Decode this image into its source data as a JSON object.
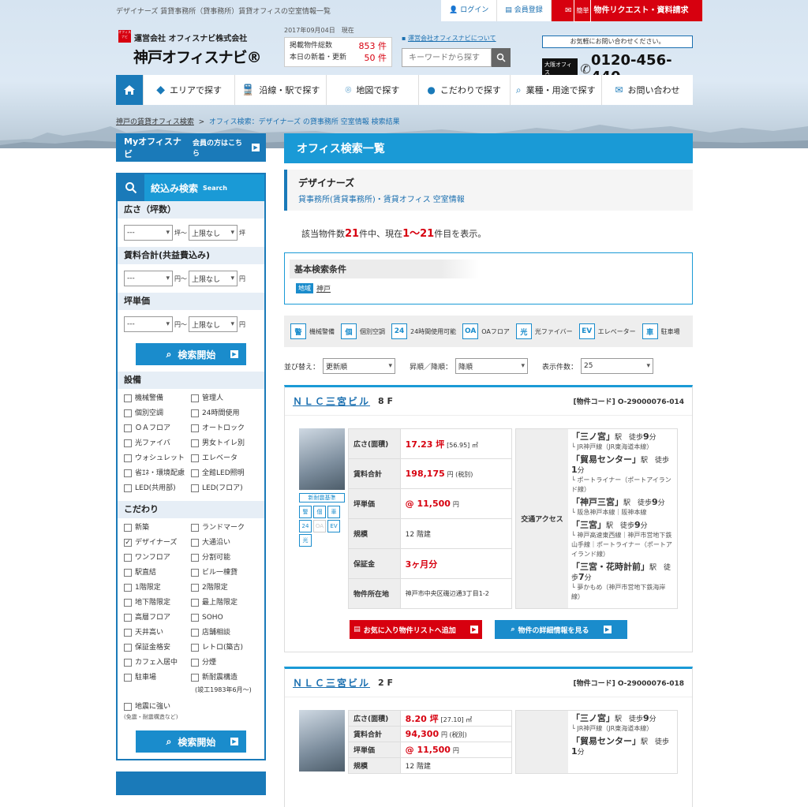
{
  "header": {
    "tagline": "デザイナーズ 賃貸事務所（貸事務所）賃貸オフィスの空室情報一覧",
    "login": "ログイン",
    "register": "会員登録",
    "request_tag": "簡単",
    "request": "物件リクエスト・資料請求",
    "logo_mark": "オフィスナビ",
    "company": "運営会社 オフィスナビ株式会社",
    "logo": "神戸オフィスナビ®",
    "date": "2017年09月04日　現在",
    "total_label": "掲載物件総数",
    "total_value": "853 件",
    "new_label": "本日の新着・更新",
    "new_value": "50 件",
    "about": "運営会社オフィスナビについて",
    "search_placeholder": "キーワードから探す",
    "contact_q": "お気軽にお問い合わせください。",
    "osaka": "大阪オフィス",
    "tel": "0120-456-440"
  },
  "nav": [
    "エリアで探す",
    "沿線・駅で探す",
    "地図で探す",
    "こだわりで探す",
    "業種・用途で探す",
    "お問い合わせ"
  ],
  "breadcrumb": {
    "home": "神戸の賃貸オフィス検索",
    "sep": ">",
    "current": "オフィス検索：デザイナーズ の貸事務所 空室情報 検索結果"
  },
  "sidebar": {
    "my_label": "Myオフィスナビ",
    "my_sub": "会員の方はこちら",
    "filter_title": "絞込み検索",
    "filter_sub": "Search",
    "area_hd": "広さ（坪数）",
    "area_unit1": "坪～",
    "area_unit2": "坪",
    "rent_hd": "賃料合計(共益費込み)",
    "yen1": "円～",
    "yen2": "円",
    "tsubo_hd": "坪単価",
    "min_val": "---",
    "max_val": "上限なし",
    "search_btn": "検索開始",
    "equip_hd": "設備",
    "equip": [
      "機械警備",
      "管理人",
      "個別空調",
      "24時間使用",
      "ＯＡフロア",
      "オートロック",
      "光ファイバ",
      "男女トイレ別",
      "ウォシュレット",
      "エレベータ",
      "省ｴﾈ・環境配慮",
      "全館LED照明",
      "LED(共用部)",
      "LED(フロア)"
    ],
    "pref_hd": "こだわり",
    "pref": [
      "新築",
      "ランドマーク",
      "デザイナーズ",
      "大通沿い",
      "ワンフロア",
      "分割可能",
      "駅直結",
      "ビル一棟貸",
      "1階限定",
      "2階限定",
      "地下階限定",
      "最上階限定",
      "高層フロア",
      "SOHO",
      "天井高い",
      "店舗相談",
      "保証金格安",
      "レトロ(築古)",
      "カフェ入居中",
      "分煙",
      "駐車場",
      "新耐震構造"
    ],
    "pref_note": "(竣工1983年6月～)",
    "quake": "地震に強い",
    "quake_note": "(免震・耐震構造など)"
  },
  "main": {
    "title": "オフィス検索一覧",
    "cond_t1": "デザイナーズ",
    "cond_t2": "貸事務所(賃貸事務所)・賃貸オフィス 空室情報",
    "count_pre": "該当物件数",
    "count_total": "21",
    "count_mid": "件中、現在",
    "count_range": "1～21",
    "count_post": "件目を表示。",
    "basic_title": "基本検索条件",
    "area_tag": "地域",
    "area_val": "神戸",
    "legend": [
      {
        "icon": "警",
        "label": "機械警備"
      },
      {
        "icon": "個",
        "label": "個別空調"
      },
      {
        "icon": "24",
        "label": "24時間使用可能"
      },
      {
        "icon": "OA",
        "label": "OAフロア"
      },
      {
        "icon": "光",
        "label": "光ファイバー"
      },
      {
        "icon": "EV",
        "label": "エレベーター"
      },
      {
        "icon": "車",
        "label": "駐車場"
      }
    ],
    "sort_label": "並び替え：",
    "sort_val": "更新順",
    "order_label": "昇順／降順：",
    "order_val": "降順",
    "per_label": "表示件数：",
    "per_val": "25"
  },
  "cards": [
    {
      "name": "ＮＬＣ三宮ビル",
      "floor": "8 F",
      "code": "[物件コード] O-29000076-014",
      "badge": "新耐震基準",
      "rows": [
        {
          "k": "広さ(面積)",
          "v": "17.23 坪",
          "s": "[56.95] ㎡"
        },
        {
          "k": "賃料合計",
          "v": "198,175",
          "s": "円 (税別)"
        },
        {
          "k": "坪単価",
          "v": "@ 11,500",
          "s": "円"
        },
        {
          "k": "規模",
          "v": "12 階建",
          "s": ""
        },
        {
          "k": "保証金",
          "v": "3ヶ月分",
          "s": ""
        },
        {
          "k": "物件所在地",
          "v": "神戸市中央区磯辺通3丁目1-2",
          "s": ""
        }
      ],
      "access_label": "交通アクセス",
      "access": [
        {
          "stn": "「三ノ宮」",
          "walk": "駅　徒歩",
          "min": "9",
          "unit": "分",
          "line": "└ JR神戸線（JR東海道本線）"
        },
        {
          "stn": "「貿易センター」",
          "walk": "駅　徒歩",
          "min": "1",
          "unit": "分",
          "line": "└ ポートライナー（ポートアイランド線）"
        },
        {
          "stn": "「神戸三宮」",
          "walk": "駅　徒歩",
          "min": "9",
          "unit": "分",
          "line": "└ 阪急神戸本線｜阪神本線"
        },
        {
          "stn": "「三宮」",
          "walk": "駅　徒歩",
          "min": "9",
          "unit": "分",
          "line": "└ 神戸高速東西線｜神戸市営地下鉄山手線｜ポートライナー（ポートアイランド線）"
        },
        {
          "stn": "「三宮・花時計前」",
          "walk": "駅　徒歩",
          "min": "7",
          "unit": "分",
          "line": "└ 夢かもめ（神戸市営地下鉄海岸線）"
        }
      ],
      "fav": "お気に入り物件リストへ追加",
      "detail": "物件の詳細情報を見る"
    },
    {
      "name": "ＮＬＣ三宮ビル",
      "floor": "2 F",
      "code": "[物件コード] O-29000076-018",
      "rows": [
        {
          "k": "広さ(面積)",
          "v": "8.20 坪",
          "s": "[27.10] ㎡"
        },
        {
          "k": "賃料合計",
          "v": "94,300",
          "s": "円 (税別)"
        },
        {
          "k": "坪単価",
          "v": "@ 11,500",
          "s": "円"
        },
        {
          "k": "規模",
          "v": "12 階建",
          "s": ""
        }
      ],
      "access": [
        {
          "stn": "「三ノ宮」",
          "walk": "駅　徒歩",
          "min": "9",
          "unit": "分",
          "line": "└ JR神戸線（JR東海道本線）"
        },
        {
          "stn": "「貿易センター」",
          "walk": "駅　徒歩",
          "min": "1",
          "unit": "分",
          "line": ""
        }
      ]
    }
  ]
}
